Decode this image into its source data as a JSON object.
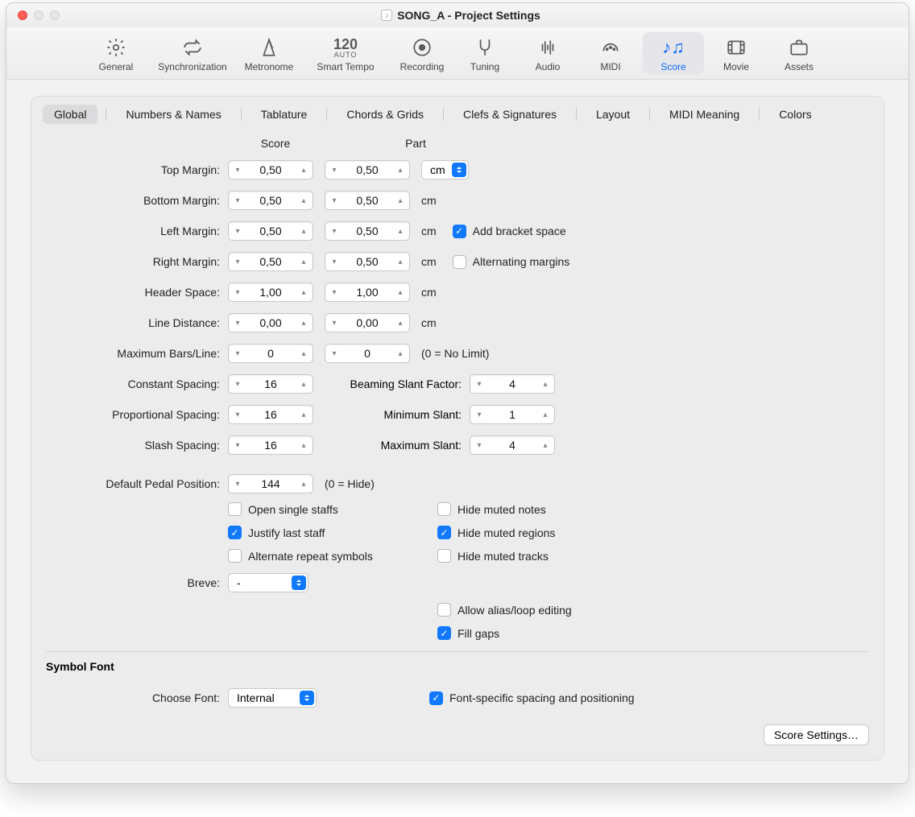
{
  "window": {
    "title": "SONG_A - Project Settings"
  },
  "toolbar": {
    "items": [
      {
        "label": "General"
      },
      {
        "label": "Synchronization"
      },
      {
        "label": "Metronome"
      },
      {
        "label": "Smart Tempo",
        "top": "120",
        "sub": "AUTO"
      },
      {
        "label": "Recording"
      },
      {
        "label": "Tuning"
      },
      {
        "label": "Audio"
      },
      {
        "label": "MIDI"
      },
      {
        "label": "Score"
      },
      {
        "label": "Movie"
      },
      {
        "label": "Assets"
      }
    ],
    "active": "Score"
  },
  "subtabs": [
    "Global",
    "Numbers & Names",
    "Tablature",
    "Chords & Grids",
    "Clefs & Signatures",
    "Layout",
    "MIDI Meaning",
    "Colors"
  ],
  "subtab_active": "Global",
  "headers": {
    "score": "Score",
    "part": "Part"
  },
  "labels": {
    "top_margin": "Top Margin:",
    "bottom_margin": "Bottom Margin:",
    "left_margin": "Left Margin:",
    "right_margin": "Right Margin:",
    "header_space": "Header Space:",
    "line_distance": "Line Distance:",
    "max_bars": "Maximum Bars/Line:",
    "constant_spacing": "Constant Spacing:",
    "proportional_spacing": "Proportional Spacing:",
    "slash_spacing": "Slash Spacing:",
    "default_pedal": "Default Pedal Position:",
    "breve": "Breve:",
    "beaming": "Beaming Slant Factor:",
    "min_slant": "Minimum Slant:",
    "max_slant": "Maximum Slant:",
    "choose_font": "Choose Font:"
  },
  "values": {
    "top_margin_score": "0,50",
    "top_margin_part": "0,50",
    "bottom_margin_score": "0,50",
    "bottom_margin_part": "0,50",
    "left_margin_score": "0,50",
    "left_margin_part": "0,50",
    "right_margin_score": "0,50",
    "right_margin_part": "0,50",
    "header_space_score": "1,00",
    "header_space_part": "1,00",
    "line_distance_score": "0,00",
    "line_distance_part": "0,00",
    "max_bars_score": "0",
    "max_bars_part": "0",
    "constant_spacing": "16",
    "proportional_spacing": "16",
    "slash_spacing": "16",
    "beaming": "4",
    "min_slant": "1",
    "max_slant": "4",
    "default_pedal": "144",
    "breve": "-",
    "choose_font": "Internal"
  },
  "unit": {
    "cm": "cm"
  },
  "hints": {
    "no_limit": "(0 = No Limit)",
    "hide": "(0 = Hide)"
  },
  "checks": {
    "add_bracket": "Add bracket space",
    "alternating": "Alternating margins",
    "open_single": "Open single staffs",
    "justify_last": "Justify last staff",
    "alternate_repeat": "Alternate repeat symbols",
    "hide_muted_notes": "Hide muted notes",
    "hide_muted_regions": "Hide muted regions",
    "hide_muted_tracks": "Hide muted tracks",
    "allow_alias": "Allow alias/loop editing",
    "fill_gaps": "Fill gaps",
    "font_specific": "Font-specific spacing and positioning"
  },
  "check_state": {
    "add_bracket": true,
    "alternating": false,
    "open_single": false,
    "justify_last": true,
    "alternate_repeat": false,
    "hide_muted_notes": false,
    "hide_muted_regions": true,
    "hide_muted_tracks": false,
    "allow_alias": false,
    "fill_gaps": true,
    "font_specific": true
  },
  "section": {
    "symbol_font": "Symbol Font"
  },
  "buttons": {
    "score_settings": "Score Settings…"
  }
}
